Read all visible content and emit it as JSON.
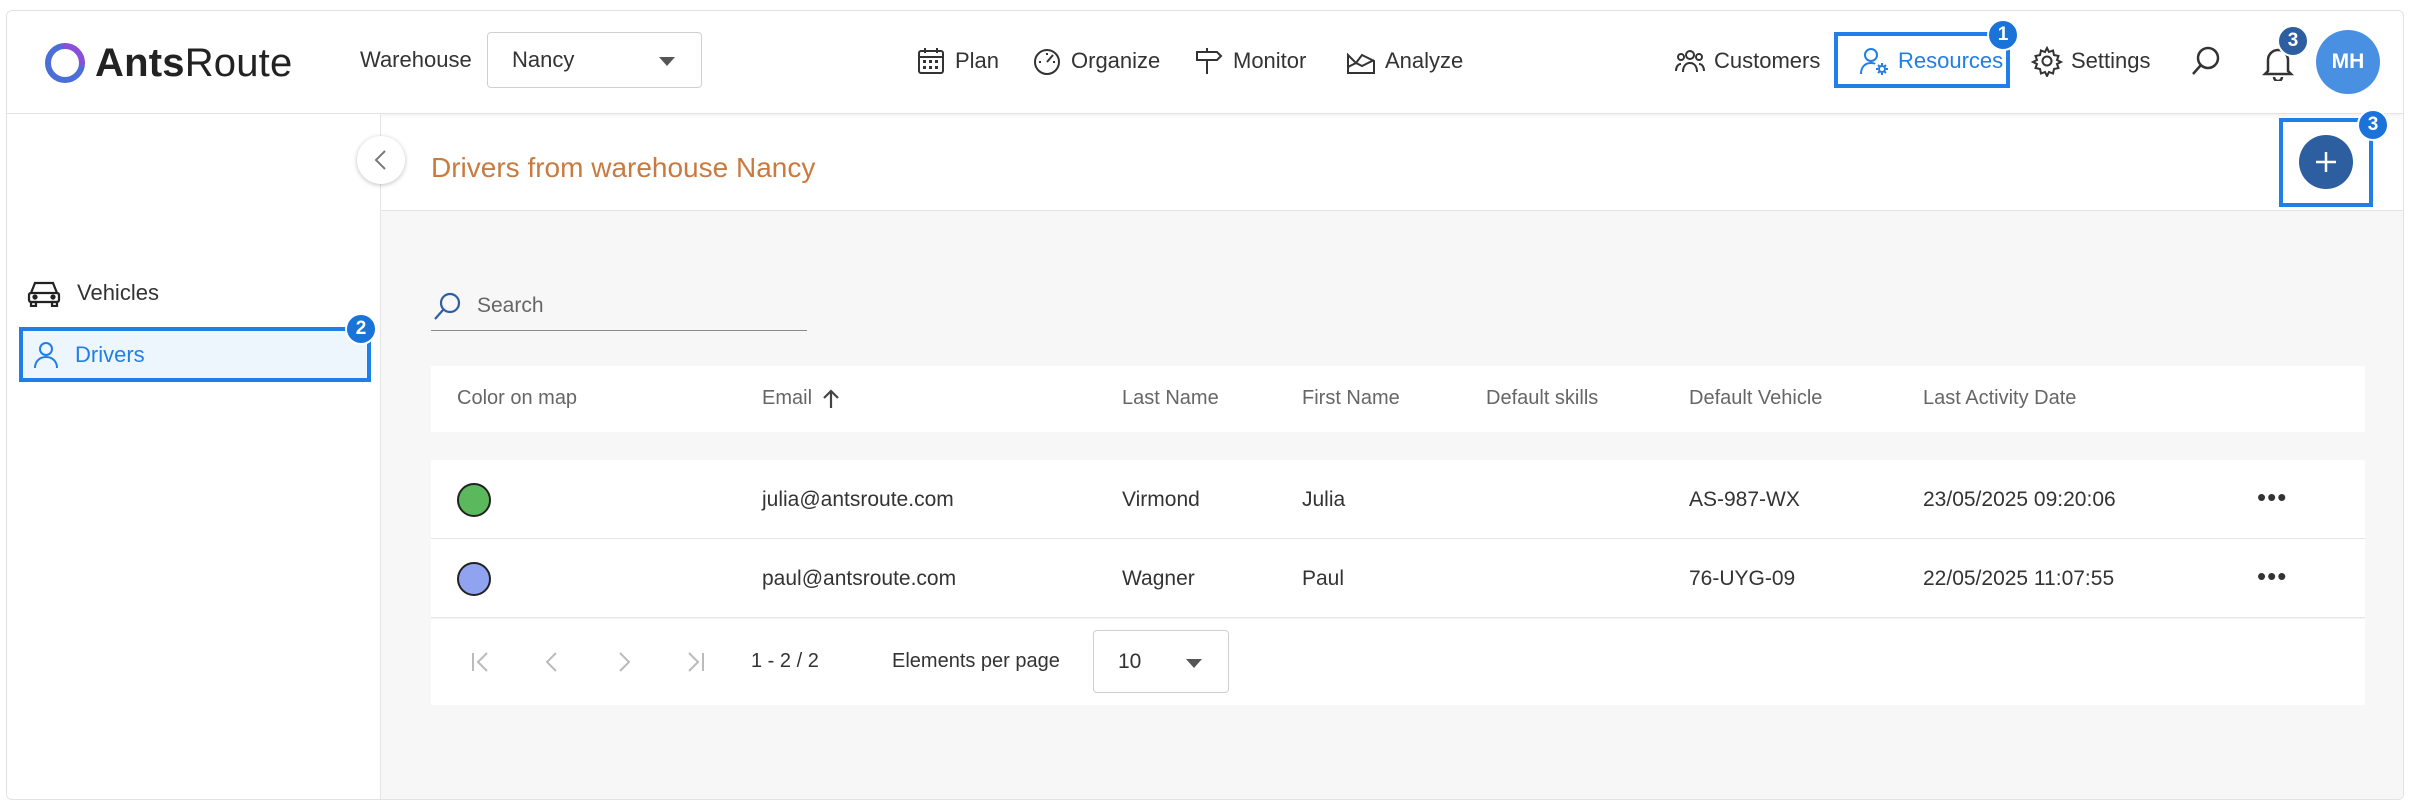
{
  "brand": {
    "name_bold": "Ants",
    "name_regular": "Route",
    "accent": "#2d5fa0"
  },
  "header": {
    "warehouse_label": "Warehouse",
    "warehouse_value": "Nancy",
    "nav": [
      {
        "label": "Plan",
        "icon": "calendar-icon"
      },
      {
        "label": "Organize",
        "icon": "speedometer-icon"
      },
      {
        "label": "Monitor",
        "icon": "signpost-icon"
      },
      {
        "label": "Analyze",
        "icon": "area-chart-icon"
      }
    ],
    "right_nav": [
      {
        "label": "Customers",
        "icon": "users-group-icon"
      },
      {
        "label": "Resources",
        "icon": "user-gear-icon",
        "active": true,
        "color": "#1f7fe6"
      },
      {
        "label": "Settings",
        "icon": "gear-icon"
      }
    ],
    "notifications_count": "3",
    "avatar_initials": "MH"
  },
  "annotations": {
    "step1": "1",
    "step2": "2",
    "step3": "3",
    "highlight_color": "#1f7fe6"
  },
  "sidebar": {
    "items": [
      {
        "label": "Vehicles",
        "icon": "car-icon"
      },
      {
        "label": "Drivers",
        "icon": "user-icon",
        "active": true
      }
    ]
  },
  "main": {
    "title": "Drivers from warehouse Nancy",
    "search_placeholder": "Search",
    "columns": [
      "Color on map",
      "Email",
      "Last Name",
      "First Name",
      "Default skills",
      "Default Vehicle",
      "Last Activity Date"
    ],
    "rows": [
      {
        "color": "#5cb85c",
        "email": "julia@antsroute.com",
        "last_name": "Virmond",
        "first_name": "Julia",
        "skills": "",
        "vehicle": "AS-987-WX",
        "last_activity": "23/05/2025 09:20:06"
      },
      {
        "color": "#8fa3f0",
        "email": "paul@antsroute.com",
        "last_name": "Wagner",
        "first_name": "Paul",
        "skills": "",
        "vehicle": "76-UYG-09",
        "last_activity": "22/05/2025 11:07:55"
      }
    ],
    "pagination": {
      "range": "1 - 2 / 2",
      "per_page_label": "Elements per page",
      "per_page_value": "10"
    }
  }
}
